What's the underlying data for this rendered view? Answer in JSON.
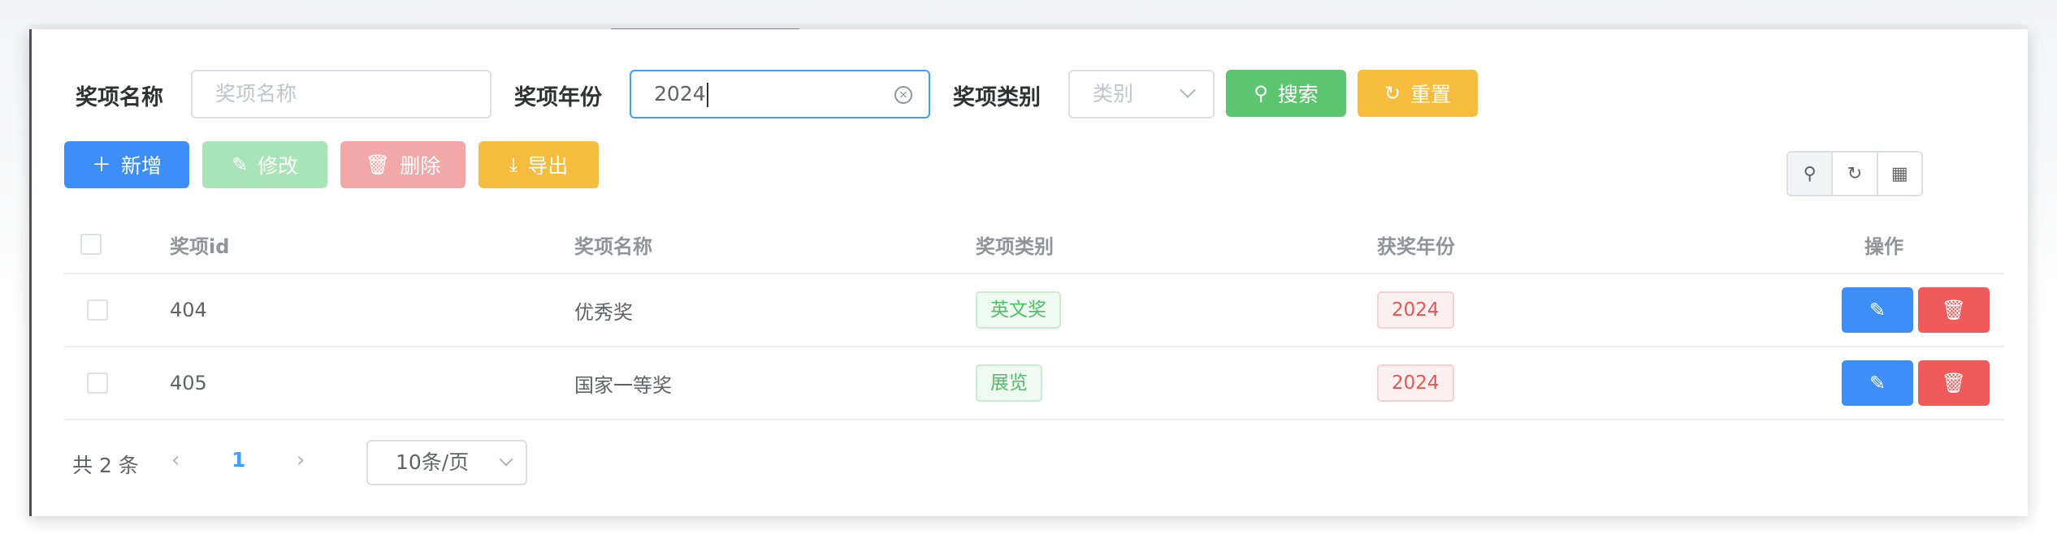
{
  "search": {
    "name_label": "奖项名称",
    "name_placeholder": "奖项名称",
    "year_label": "奖项年份",
    "year_value": "2024",
    "category_label": "奖项类别",
    "category_placeholder": "类别",
    "search_button": "搜索",
    "reset_button": "重置"
  },
  "toolbar": {
    "add": "新增",
    "edit": "修改",
    "delete": "删除",
    "export": "导出"
  },
  "right_tools": [
    "search-icon",
    "refresh-icon",
    "grid-icon"
  ],
  "table": {
    "columns": [
      "奖项id",
      "奖项名称",
      "奖项类别",
      "获奖年份",
      "操作"
    ],
    "rows": [
      {
        "id": "404",
        "name": "优秀奖",
        "category": "英文奖",
        "year": "2024"
      },
      {
        "id": "405",
        "name": "国家一等奖",
        "category": "展览",
        "year": "2024"
      }
    ]
  },
  "pagination": {
    "total": "共 2 条",
    "current_page": "1",
    "page_size": "10条/页"
  },
  "colors": {
    "primary": "#3e8ef7",
    "success": "#5cc56f",
    "warning": "#f5bc3d",
    "danger": "#ef5b5b"
  }
}
